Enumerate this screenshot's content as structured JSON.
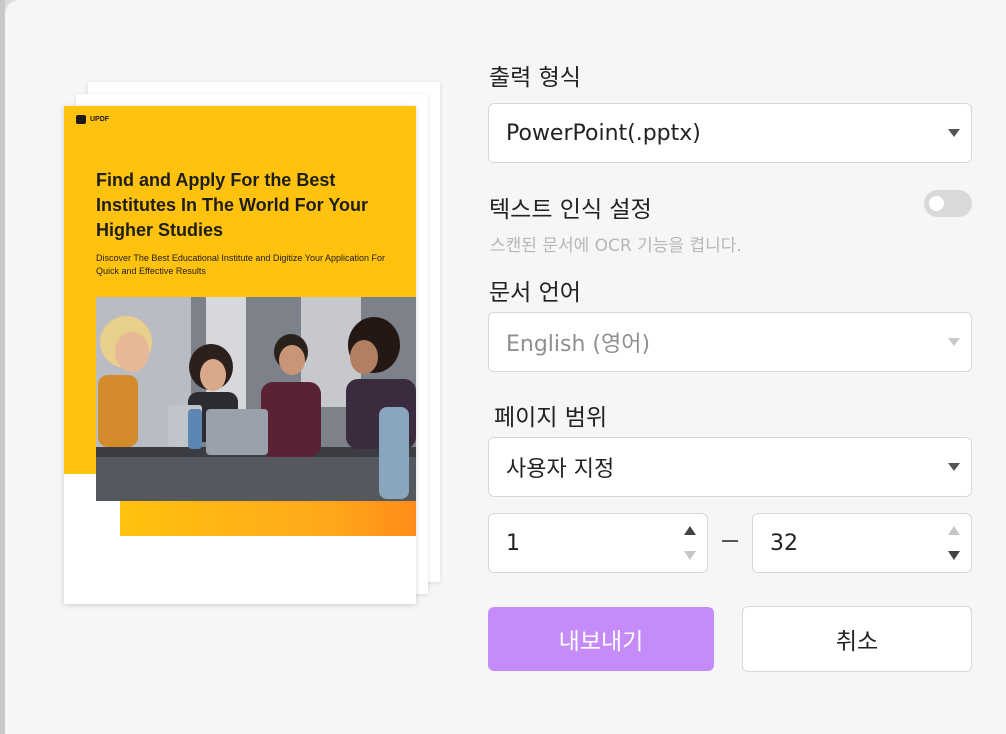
{
  "preview": {
    "logo_text": "UPDF",
    "title": "Find and Apply For the Best Institutes In The World For Your Higher Studies",
    "subtitle": "Discover The Best Educational Institute and Digitize Your Application For Quick and Effective Results"
  },
  "form": {
    "output_format": {
      "label": "출력 형식",
      "value": "PowerPoint(.pptx)"
    },
    "ocr": {
      "label": "텍스트 인식 설정",
      "hint": "스캔된 문서에 OCR 기능을 켭니다.",
      "enabled": false
    },
    "language": {
      "label": "문서 언어",
      "value": "English (영어)"
    },
    "page_range": {
      "label": "페이지 범위",
      "value": "사용자 지정",
      "from": "1",
      "to": "32"
    }
  },
  "buttons": {
    "export": "내보내기",
    "cancel": "취소"
  },
  "colors": {
    "accent": "#c58cf9",
    "page_yellow": "#ffc20e"
  }
}
